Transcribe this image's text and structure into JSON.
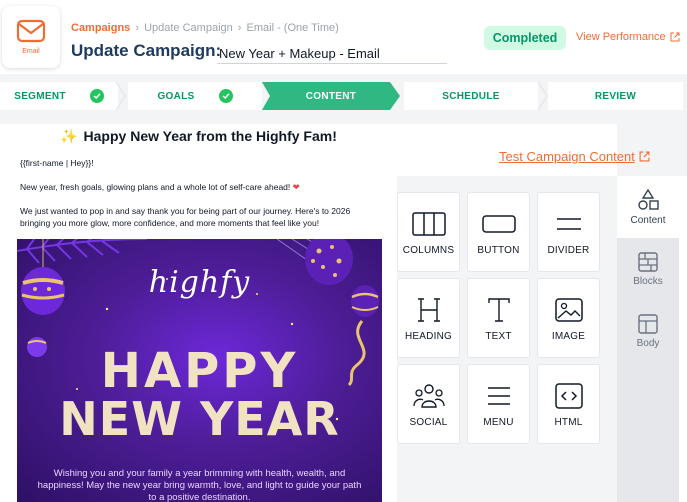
{
  "header": {
    "email_tile_label": "Email",
    "breadcrumbs": [
      "Campaigns",
      "Update Campaign",
      "Email - (One Time)"
    ],
    "title": "Update Campaign:",
    "campaign_name": "New Year + Makeup - Email",
    "status": "Completed",
    "view_performance": "View Performance"
  },
  "steps": [
    {
      "label": "SEGMENT",
      "state": "done"
    },
    {
      "label": "GOALS",
      "state": "done"
    },
    {
      "label": "CONTENT",
      "state": "active"
    },
    {
      "label": "SCHEDULE",
      "state": "pending"
    },
    {
      "label": "REVIEW",
      "state": "pending"
    }
  ],
  "preview": {
    "title": "Happy New Year from the Highfy Fam!",
    "greeting": "{{first-name | Hey}}!",
    "line1": "New year, fresh goals, glowing plans and a whole lot of self-care ahead!",
    "line2": "We just wanted to pop in and say thank you for being part of our journey. Here's to 2026 bringing you more glow, more confidence, and more moments that feel like you!",
    "banner_brand": "highfy",
    "banner_line1": "HAPPY",
    "banner_line2": "NEW YEAR",
    "banner_wish": "Wishing you and your family a year brimming with health, wealth, and happiness! May the new year bring warmth, love, and light to guide your path to a positive destination."
  },
  "builder": {
    "test_link": "Test Campaign Content",
    "tiles": [
      {
        "label": "COLUMNS",
        "icon": "columns-icon"
      },
      {
        "label": "BUTTON",
        "icon": "button-icon"
      },
      {
        "label": "DIVIDER",
        "icon": "divider-icon"
      },
      {
        "label": "HEADING",
        "icon": "heading-icon"
      },
      {
        "label": "TEXT",
        "icon": "text-icon"
      },
      {
        "label": "IMAGE",
        "icon": "image-icon"
      },
      {
        "label": "SOCIAL",
        "icon": "social-icon"
      },
      {
        "label": "MENU",
        "icon": "menu-icon"
      },
      {
        "label": "HTML",
        "icon": "html-icon"
      }
    ],
    "side_tabs": [
      {
        "label": "Content",
        "icon": "content-shapes-icon",
        "active": true
      },
      {
        "label": "Blocks",
        "icon": "blocks-icon",
        "active": false
      },
      {
        "label": "Body",
        "icon": "body-icon",
        "active": false
      }
    ]
  },
  "colors": {
    "accent": "#ef6c35",
    "success": "#2fb882",
    "banner_purple": "#4c1d95",
    "banner_gold": "#f1e3c2"
  }
}
